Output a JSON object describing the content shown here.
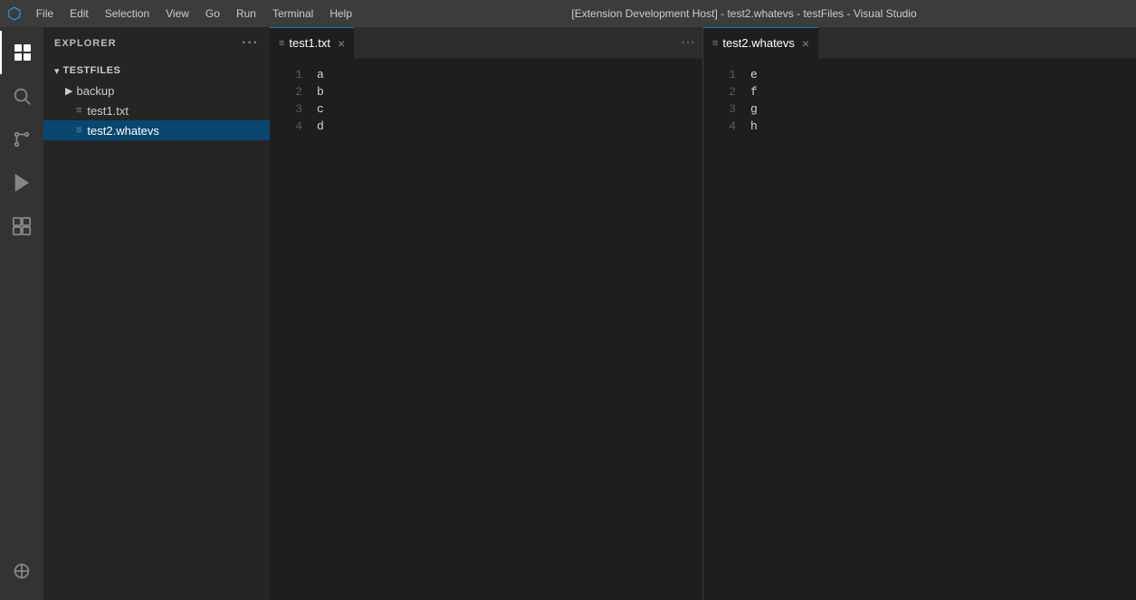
{
  "titlebar": {
    "title": "[Extension Development Host] - test2.whatevs - testFiles - Visual Studio",
    "menu_items": [
      "File",
      "Edit",
      "Selection",
      "View",
      "Go",
      "Run",
      "Terminal",
      "Help"
    ]
  },
  "activity_bar": {
    "icons": [
      {
        "name": "vscode-logo",
        "symbol": "⬡",
        "active": true
      },
      {
        "name": "explorer-icon",
        "symbol": "⧉",
        "active": true
      },
      {
        "name": "search-icon",
        "symbol": "🔍",
        "active": false
      },
      {
        "name": "source-control-icon",
        "symbol": "⑂",
        "active": false
      },
      {
        "name": "run-icon",
        "symbol": "▷",
        "active": false
      },
      {
        "name": "extensions-icon",
        "symbol": "⊞",
        "active": false
      },
      {
        "name": "remote-icon",
        "symbol": "⊙",
        "active": false
      }
    ]
  },
  "sidebar": {
    "header": "Explorer",
    "more_label": "···",
    "tree": {
      "root_folder": "TESTFILES",
      "items": [
        {
          "type": "subfolder",
          "name": "backup",
          "icon": "▶"
        },
        {
          "type": "file",
          "name": "test1.txt",
          "icon": "≡",
          "active": false
        },
        {
          "type": "file",
          "name": "test2.whatevs",
          "icon": "≡",
          "active": true
        }
      ]
    }
  },
  "editor": {
    "panes": [
      {
        "tab_icon": "≡",
        "tab_label": "test1.txt",
        "tab_close": "×",
        "more": "···",
        "breadcrumb": "test1.txt",
        "lines": [
          {
            "num": "1",
            "content": "a"
          },
          {
            "num": "2",
            "content": "b"
          },
          {
            "num": "3",
            "content": "c"
          },
          {
            "num": "4",
            "content": "d"
          }
        ]
      },
      {
        "tab_icon": "≡",
        "tab_label": "test2.whatevs",
        "tab_close": "×",
        "more": "",
        "breadcrumb": "test2.whatevs",
        "lines": [
          {
            "num": "1",
            "content": "e"
          },
          {
            "num": "2",
            "content": "f"
          },
          {
            "num": "3",
            "content": "g"
          },
          {
            "num": "4",
            "content": "h"
          }
        ]
      }
    ]
  }
}
